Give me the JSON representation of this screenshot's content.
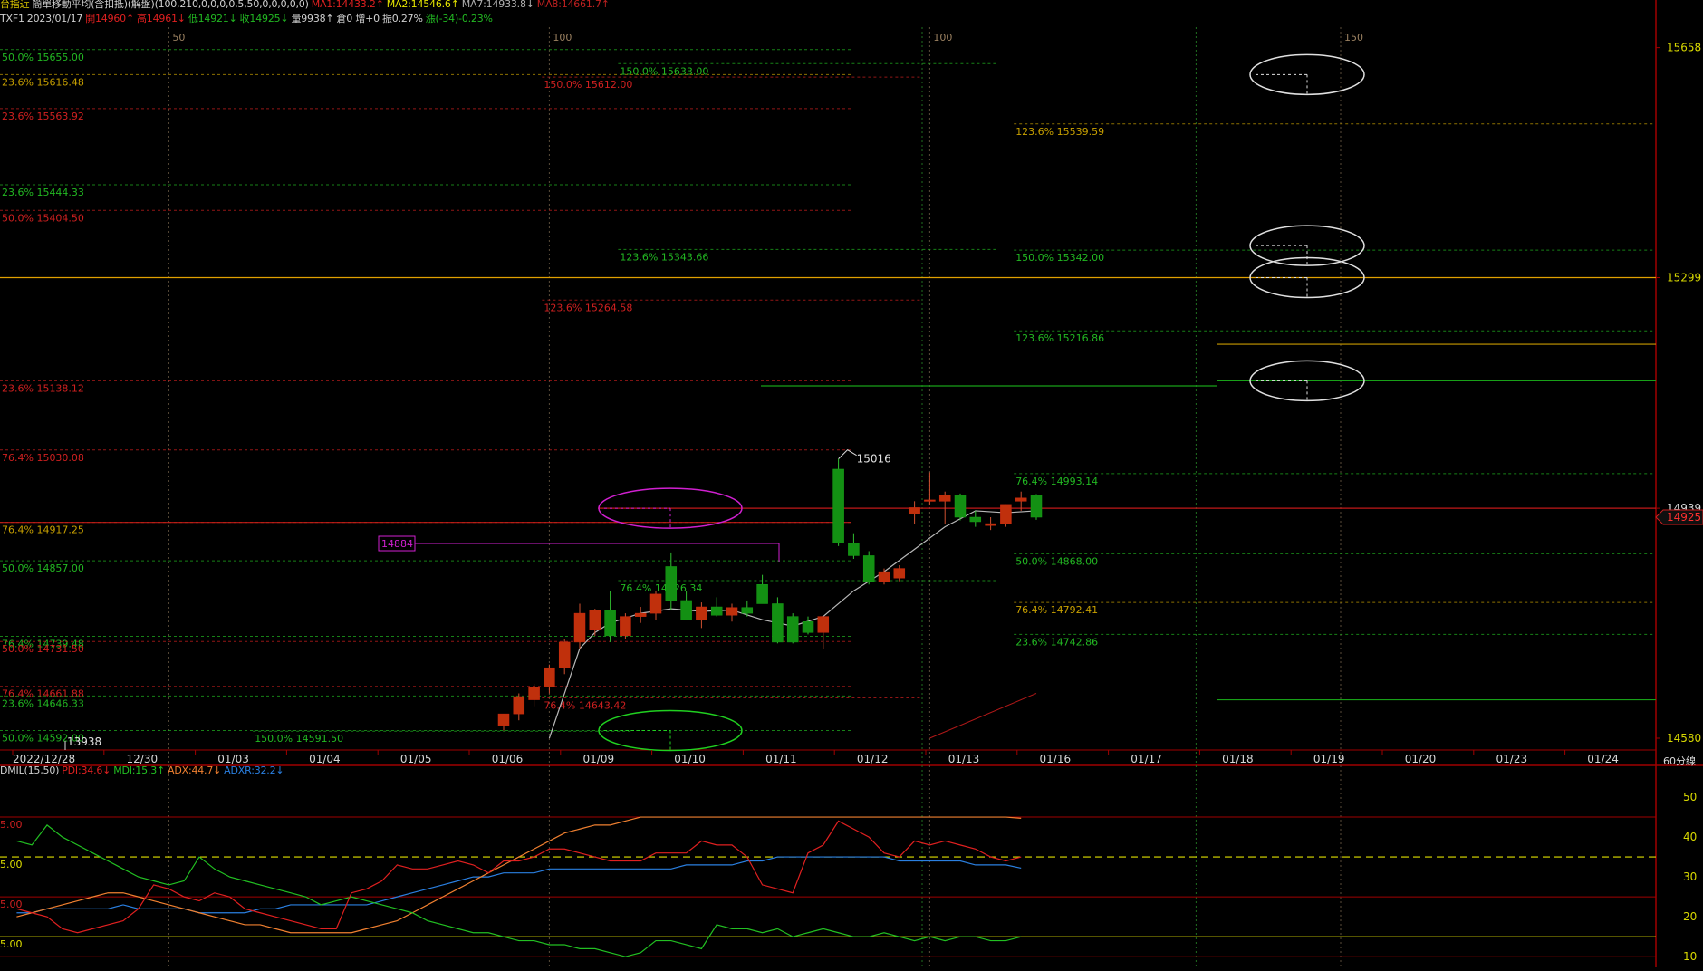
{
  "header": {
    "line1": [
      {
        "text": "台指近",
        "color": "#d6c200"
      },
      {
        "text": "簡單移動平均(含扣抵)(解盤)(100,210,0,0,0,0,5,50,0,0,0,0,0)",
        "color": "#d0d0d0"
      },
      {
        "text": "MA1:14433.2↑",
        "color": "#e02020"
      },
      {
        "text": "MA2:14546.6↑",
        "color": "#e6e600"
      },
      {
        "text": "MA7:14933.8↓",
        "color": "#b0b0b0"
      },
      {
        "text": "MA8:14661.7↑",
        "color": "#c02020"
      }
    ],
    "line2": [
      {
        "text": "TXF1",
        "color": "#d0d0d0"
      },
      {
        "text": "2023/01/17",
        "color": "#d0d0d0"
      },
      {
        "text": "開14960↑",
        "color": "#e02020"
      },
      {
        "text": "高14961↓",
        "color": "#e02020"
      },
      {
        "text": "低14921↓",
        "color": "#22b822"
      },
      {
        "text": "收14925↓",
        "color": "#22b822"
      },
      {
        "text": "量9938↑",
        "color": "#d0d0d0"
      },
      {
        "text": "倉0 增+0",
        "color": "#d0d0d0"
      },
      {
        "text": "振0.27%",
        "color": "#d0d0d0"
      },
      {
        "text": "漲(-34)-0.23%",
        "color": "#22b822"
      }
    ],
    "line3": [
      {
        "text": "DMIL(15,50)",
        "color": "#d0d0d0"
      },
      {
        "text": "PDI:34.6↓",
        "color": "#e02020"
      },
      {
        "text": "MDI:15.3↑",
        "color": "#22c022"
      },
      {
        "text": "ADX:44.7↓",
        "color": "#f08030"
      },
      {
        "text": "ADXR:32.2↓",
        "color": "#2a7fe0"
      }
    ]
  },
  "timeframe": "60分線",
  "chart_data": {
    "type": "candlestick",
    "y_range": [
      14580,
      15690
    ],
    "y_ticks": [
      15658,
      15299,
      14939,
      14580
    ],
    "current_price": "14925",
    "x_labels": [
      "2022/12/28",
      "12/30",
      "01/03",
      "01/04",
      "01/05",
      "01/06",
      "01/09",
      "01/10",
      "01/11",
      "01/12",
      "01/13",
      "01/16",
      "01/17",
      "01/18",
      "01/19",
      "01/20",
      "01/23",
      "01/24"
    ],
    "bar_counter_labels": [
      {
        "i": 10,
        "text": "50"
      },
      {
        "i": 35,
        "text": "100"
      },
      {
        "i": 60,
        "text": "100"
      },
      {
        "i": 87,
        "text": "150"
      }
    ],
    "candles": [
      {
        "i": 32,
        "o": 14600,
        "h": 14618,
        "l": 14592,
        "c": 14618
      },
      {
        "i": 33,
        "o": 14618,
        "h": 14650,
        "l": 14608,
        "c": 14645
      },
      {
        "i": 34,
        "o": 14640,
        "h": 14665,
        "l": 14630,
        "c": 14660
      },
      {
        "i": 35,
        "o": 14660,
        "h": 14695,
        "l": 14650,
        "c": 14690
      },
      {
        "i": 36,
        "o": 14690,
        "h": 14735,
        "l": 14680,
        "c": 14730
      },
      {
        "i": 37,
        "o": 14730,
        "h": 14790,
        "l": 14720,
        "c": 14775
      },
      {
        "i": 38,
        "o": 14750,
        "h": 14782,
        "l": 14740,
        "c": 14780
      },
      {
        "i": 39,
        "o": 14780,
        "h": 14810,
        "l": 14730,
        "c": 14740
      },
      {
        "i": 40,
        "o": 14740,
        "h": 14775,
        "l": 14735,
        "c": 14770
      },
      {
        "i": 41,
        "o": 14770,
        "h": 14785,
        "l": 14760,
        "c": 14775
      },
      {
        "i": 42,
        "o": 14775,
        "h": 14810,
        "l": 14765,
        "c": 14805
      },
      {
        "i": 43,
        "o": 14848,
        "h": 14870,
        "l": 14780,
        "c": 14795
      },
      {
        "i": 44,
        "o": 14795,
        "h": 14810,
        "l": 14765,
        "c": 14765
      },
      {
        "i": 45,
        "o": 14765,
        "h": 14792,
        "l": 14752,
        "c": 14785
      },
      {
        "i": 46,
        "o": 14785,
        "h": 14800,
        "l": 14770,
        "c": 14772
      },
      {
        "i": 47,
        "o": 14772,
        "h": 14790,
        "l": 14762,
        "c": 14784
      },
      {
        "i": 48,
        "o": 14784,
        "h": 14795,
        "l": 14770,
        "c": 14775
      },
      {
        "i": 49,
        "o": 14820,
        "h": 14835,
        "l": 14790,
        "c": 14790
      },
      {
        "i": 50,
        "o": 14790,
        "h": 14800,
        "l": 14728,
        "c": 14730
      },
      {
        "i": 51,
        "o": 14770,
        "h": 14775,
        "l": 14728,
        "c": 14730
      },
      {
        "i": 52,
        "o": 14762,
        "h": 14770,
        "l": 14742,
        "c": 14745
      },
      {
        "i": 53,
        "o": 14745,
        "h": 14770,
        "l": 14720,
        "c": 14770
      },
      {
        "i": 54,
        "o": 15000,
        "h": 15016,
        "l": 14880,
        "c": 14885
      },
      {
        "i": 55,
        "o": 14885,
        "h": 14900,
        "l": 14860,
        "c": 14865
      },
      {
        "i": 56,
        "o": 14865,
        "h": 14872,
        "l": 14820,
        "c": 14825
      },
      {
        "i": 57,
        "o": 14825,
        "h": 14845,
        "l": 14820,
        "c": 14840
      },
      {
        "i": 58,
        "o": 14830,
        "h": 14850,
        "l": 14825,
        "c": 14845
      },
      {
        "i": 59,
        "o": 14930,
        "h": 14950,
        "l": 14915,
        "c": 14940
      },
      {
        "i": 60,
        "o": 14950,
        "h": 14995,
        "l": 14945,
        "c": 14952
      },
      {
        "i": 61,
        "o": 14950,
        "h": 14965,
        "l": 14915,
        "c": 14960
      },
      {
        "i": 62,
        "o": 14960,
        "h": 14962,
        "l": 14920,
        "c": 14925
      },
      {
        "i": 63,
        "o": 14925,
        "h": 14935,
        "l": 14910,
        "c": 14918
      },
      {
        "i": 64,
        "o": 14912,
        "h": 14925,
        "l": 14905,
        "c": 14915
      },
      {
        "i": 65,
        "o": 14915,
        "h": 14945,
        "l": 14910,
        "c": 14945
      },
      {
        "i": 66,
        "o": 14950,
        "h": 14965,
        "l": 14935,
        "c": 14955
      },
      {
        "i": 67,
        "o": 14960,
        "h": 14961,
        "l": 14921,
        "c": 14925
      }
    ],
    "ma_gray": [
      {
        "i": 35,
        "v": 14580
      },
      {
        "i": 37,
        "v": 14720
      },
      {
        "i": 38,
        "v": 14745
      },
      {
        "i": 39,
        "v": 14760
      },
      {
        "i": 41,
        "v": 14775
      },
      {
        "i": 43,
        "v": 14782
      },
      {
        "i": 45,
        "v": 14778
      },
      {
        "i": 47,
        "v": 14780
      },
      {
        "i": 49,
        "v": 14765
      },
      {
        "i": 51,
        "v": 14755
      },
      {
        "i": 53,
        "v": 14770
      },
      {
        "i": 55,
        "v": 14810
      },
      {
        "i": 57,
        "v": 14840
      },
      {
        "i": 59,
        "v": 14875
      },
      {
        "i": 61,
        "v": 14910
      },
      {
        "i": 63,
        "v": 14935
      },
      {
        "i": 65,
        "v": 14932
      },
      {
        "i": 67,
        "v": 14935
      }
    ],
    "ma_red": [
      {
        "i": 60,
        "v": 14580
      },
      {
        "i": 67,
        "v": 14650
      }
    ],
    "fib_labels": [
      {
        "text": "50.0% 15655.00",
        "color": "#22b822",
        "i": 0,
        "v": 15655
      },
      {
        "text": "23.6% 15616.48",
        "color": "#c8a000",
        "i": 0,
        "v": 15616
      },
      {
        "text": "23.6% 15563.92",
        "color": "#d02020",
        "i": 0,
        "v": 15563
      },
      {
        "text": "23.6% 15444.33",
        "color": "#22b822",
        "i": 0,
        "v": 15444
      },
      {
        "text": "50.0% 15404.50",
        "color": "#d02020",
        "i": 0,
        "v": 15404
      },
      {
        "text": "23.6% 15138.12",
        "color": "#d02020",
        "i": 0,
        "v": 15138
      },
      {
        "text": "76.4% 15030.08",
        "color": "#d02020",
        "i": 0,
        "v": 15030
      },
      {
        "text": "76.4% 14917.25",
        "color": "#c8a000",
        "i": 0,
        "v": 14917
      },
      {
        "text": "50.0% 14857.00",
        "color": "#22b822",
        "i": 0,
        "v": 14857
      },
      {
        "text": "76.4% 14739.48",
        "color": "#22b822",
        "i": 0,
        "v": 14739
      },
      {
        "text": "50.0% 14731.50",
        "color": "#d02020",
        "i": 0,
        "v": 14731
      },
      {
        "text": "76.4% 14661.88",
        "color": "#d02020",
        "i": 0,
        "v": 14661
      },
      {
        "text": "23.6% 14646.33",
        "color": "#22b822",
        "i": 0,
        "v": 14646
      },
      {
        "text": "50.0% 14592.00",
        "color": "#22b822",
        "i": 0,
        "v": 14592
      },
      {
        "text": "150.0% 15612.00",
        "color": "#d02020",
        "i": 35,
        "v": 15612
      },
      {
        "text": "123.6% 15264.58",
        "color": "#d02020",
        "i": 35,
        "v": 15264
      },
      {
        "text": "76.4% 14643.42",
        "color": "#d02020",
        "i": 35,
        "v": 14643
      },
      {
        "text": "150.0% 15633.00",
        "color": "#22b822",
        "i": 40,
        "v": 15633
      },
      {
        "text": "123.6% 15343.66",
        "color": "#22b822",
        "i": 40,
        "v": 15343
      },
      {
        "text": "76.4% 14826.34",
        "color": "#22b822",
        "i": 40,
        "v": 14826
      },
      {
        "text": "150.0% 14591.50",
        "color": "#22b822",
        "i": 16,
        "v": 14591
      },
      {
        "text": "123.6% 15539.59",
        "color": "#c8a000",
        "i": 66,
        "v": 15539
      },
      {
        "text": "150.0% 15342.00",
        "color": "#22b822",
        "i": 66,
        "v": 15342
      },
      {
        "text": "123.6% 15216.86",
        "color": "#22b822",
        "i": 66,
        "v": 15216
      },
      {
        "text": "76.4% 14993.14",
        "color": "#22b822",
        "i": 66,
        "v": 14993
      },
      {
        "text": "50.0% 14868.00",
        "color": "#22b822",
        "i": 66,
        "v": 14868
      },
      {
        "text": "76.4% 14792.41",
        "color": "#c8a000",
        "i": 66,
        "v": 14792
      },
      {
        "text": "23.6% 14742.86",
        "color": "#22b822",
        "i": 66,
        "v": 14742
      }
    ],
    "annotations": {
      "high_label": "15016",
      "low_label": "13938",
      "box_label": "14884"
    },
    "dmi": {
      "y_range": [
        8,
        55
      ],
      "y_ticks": [
        50,
        40,
        30,
        20,
        10
      ],
      "left_ticks": [
        "5.00",
        "5.00",
        "5.00",
        "5.00"
      ],
      "pdi": [
        22,
        21,
        20,
        17,
        16,
        17,
        18,
        19,
        22,
        28,
        27,
        25,
        24,
        26,
        25,
        22,
        21,
        20,
        19,
        18,
        17,
        17,
        26,
        27,
        29,
        33,
        32,
        32,
        33,
        34,
        33,
        31,
        34,
        34,
        35,
        37,
        37,
        36,
        35,
        34,
        34,
        34,
        36,
        36,
        36,
        39,
        38,
        38,
        35,
        28,
        27,
        26,
        36,
        38,
        44,
        42,
        40,
        36,
        35,
        39,
        38,
        39,
        38,
        37,
        35,
        34,
        35
      ],
      "mdi": [
        39,
        38,
        43,
        40,
        38,
        36,
        34,
        32,
        30,
        29,
        28,
        29,
        35,
        32,
        30,
        29,
        28,
        27,
        26,
        25,
        23,
        24,
        25,
        24,
        23,
        22,
        21,
        19,
        18,
        17,
        16,
        16,
        15,
        14,
        14,
        13,
        13,
        12,
        12,
        11,
        10,
        11,
        14,
        14,
        13,
        12,
        18,
        17,
        17,
        16,
        17,
        15,
        16,
        17,
        16,
        15,
        15,
        16,
        15,
        14,
        15,
        14,
        15,
        15,
        14,
        14,
        15
      ],
      "adx": [
        20,
        21,
        22,
        23,
        24,
        25,
        26,
        26,
        25,
        24,
        23,
        22,
        21,
        20,
        19,
        18,
        18,
        17,
        16,
        16,
        16,
        16,
        16,
        17,
        18,
        19,
        21,
        23,
        25,
        27,
        29,
        31,
        33,
        35,
        37,
        39,
        41,
        42,
        43,
        43,
        44,
        45,
        45,
        45,
        45,
        45,
        45,
        45,
        45,
        45,
        45,
        45,
        45,
        45,
        45,
        45,
        45,
        45,
        45,
        45,
        45,
        45,
        45,
        45,
        45,
        45,
        44.7
      ],
      "adxr": [
        21,
        21,
        22,
        22,
        22,
        22,
        22,
        23,
        22,
        22,
        22,
        22,
        21,
        21,
        21,
        21,
        22,
        22,
        23,
        23,
        23,
        23,
        23,
        23,
        24,
        25,
        26,
        27,
        28,
        29,
        30,
        30,
        31,
        31,
        31,
        32,
        32,
        32,
        32,
        32,
        32,
        32,
        32,
        32,
        33,
        33,
        33,
        33,
        34,
        34,
        35,
        35,
        35,
        35,
        35,
        35,
        35,
        35,
        34,
        34,
        34,
        34,
        34,
        33,
        33,
        33,
        32.2
      ]
    }
  }
}
